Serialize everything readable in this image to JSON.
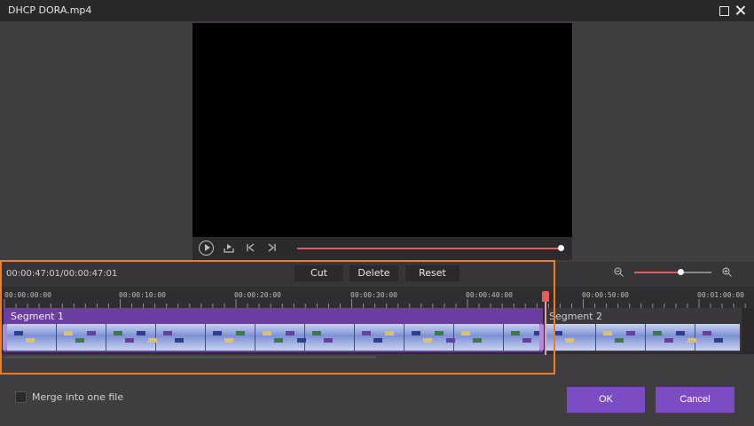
{
  "window": {
    "title": "DHCP DORA.mp4"
  },
  "player": {
    "progress_percent": 100
  },
  "toolbar": {
    "timecode": "00:00:47:01/00:00:47:01",
    "cut_label": "Cut",
    "delete_label": "Delete",
    "reset_label": "Reset",
    "zoom_percent": 60
  },
  "ruler": {
    "ticks": [
      "00:00:00:00",
      "00:00:10:00",
      "00:00:20:00",
      "00:00:30:00",
      "00:00:40:00",
      "00:00:50:00",
      "00:01:00:00"
    ]
  },
  "segments": [
    {
      "label": "Segment 1"
    },
    {
      "label": "Segment 2"
    }
  ],
  "footer": {
    "merge_label": "Merge into one file",
    "merge_checked": false,
    "ok_label": "OK",
    "cancel_label": "Cancel"
  },
  "colors": {
    "accent": "#7b4cc3",
    "segment_selected": "#6b3ea2",
    "playhead": "#e45e5e",
    "highlight_box": "#ef7d22"
  },
  "icons": [
    "play-icon",
    "export-icon",
    "previous-frame-icon",
    "next-frame-icon",
    "zoom-out-icon",
    "zoom-in-icon",
    "maximize-icon",
    "close-icon"
  ]
}
